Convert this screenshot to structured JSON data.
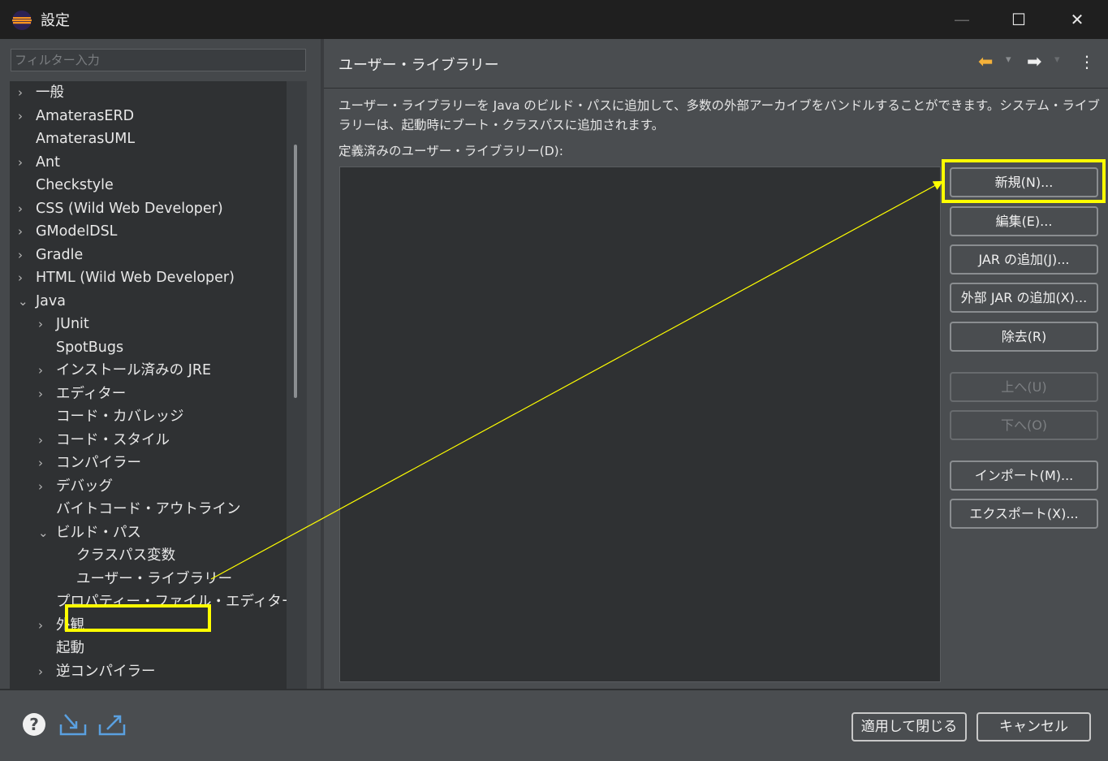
{
  "window": {
    "title": "設定"
  },
  "filter": {
    "placeholder": "フィルター入力"
  },
  "tree": [
    {
      "label": "一般",
      "chevron": "›"
    },
    {
      "label": "AmaterasERD",
      "chevron": "›"
    },
    {
      "label": "AmaterasUML",
      "chevron": ""
    },
    {
      "label": "Ant",
      "chevron": "›"
    },
    {
      "label": "Checkstyle",
      "chevron": ""
    },
    {
      "label": "CSS (Wild Web Developer)",
      "chevron": "›"
    },
    {
      "label": "GModelDSL",
      "chevron": "›"
    },
    {
      "label": "Gradle",
      "chevron": "›"
    },
    {
      "label": "HTML (Wild Web Developer)",
      "chevron": "›"
    },
    {
      "label": "Java",
      "chevron": "⌄"
    },
    {
      "label": "JUnit",
      "chevron": "›"
    },
    {
      "label": "SpotBugs",
      "chevron": ""
    },
    {
      "label": "インストール済みの JRE",
      "chevron": "›"
    },
    {
      "label": "エディター",
      "chevron": "›"
    },
    {
      "label": "コード・カバレッジ",
      "chevron": ""
    },
    {
      "label": "コード・スタイル",
      "chevron": "›"
    },
    {
      "label": "コンパイラー",
      "chevron": "›"
    },
    {
      "label": "デバッグ",
      "chevron": "›"
    },
    {
      "label": "バイトコード・アウトライン",
      "chevron": ""
    },
    {
      "label": "ビルド・パス",
      "chevron": "⌄"
    },
    {
      "label": "クラスパス変数",
      "chevron": ""
    },
    {
      "label": "ユーザー・ライブラリー",
      "chevron": ""
    },
    {
      "label": "プロパティー・ファイル・エディター",
      "chevron": ""
    },
    {
      "label": "外観",
      "chevron": "›"
    },
    {
      "label": "起動",
      "chevron": ""
    },
    {
      "label": "逆コンパイラー",
      "chevron": "›"
    }
  ],
  "page": {
    "title": "ユーザー・ライブラリー",
    "description": "ユーザー・ライブラリーを Java のビルド・パスに追加して、多数の外部アーカイブをバンドルすることができます。システム・ライブラリーは、起動時にブート・クラスパスに追加されます。",
    "list_label": "定義済みのユーザー・ライブラリー(D):"
  },
  "buttons": {
    "new": "新規(N)...",
    "edit": "編集(E)...",
    "add_jar": "JAR の追加(J)...",
    "add_external_jar": "外部 JAR の追加(X)...",
    "remove": "除去(R)",
    "up": "上へ(U)",
    "down": "下へ(O)",
    "import": "インポート(M)...",
    "export": "エクスポート(X)..."
  },
  "footer": {
    "apply_close": "適用して閉じる",
    "cancel": "キャンセル"
  },
  "colors": {
    "highlight": "#ffff00",
    "back_arrow": "#f4b13a"
  }
}
